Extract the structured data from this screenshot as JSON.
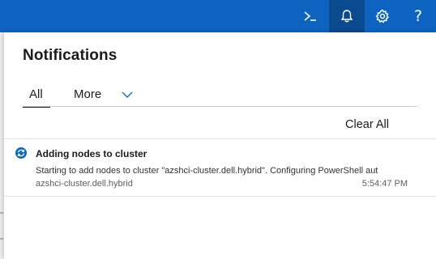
{
  "colors": {
    "topbar": "#0c64c0",
    "topbar_active": "#0a4a8f",
    "accent": "#0f6cbd",
    "text": "#1b1b1b"
  },
  "topbar": {
    "buttons": [
      {
        "icon": "powershell-icon"
      },
      {
        "icon": "bell-icon",
        "active": true
      },
      {
        "icon": "gear-icon"
      },
      {
        "icon": "help-icon",
        "glyph": "?"
      }
    ]
  },
  "panel": {
    "title": "Notifications",
    "tabs": [
      {
        "label": "All",
        "selected": true
      },
      {
        "label": "More",
        "selected": false
      }
    ],
    "clear_all_label": "Clear All",
    "notifications": [
      {
        "icon": "sync-icon",
        "title": "Adding nodes to cluster",
        "message": "Starting to add nodes to cluster \"azshci-cluster.dell.hybrid\". Configuring PowerShell aut",
        "source": "azshci-cluster.dell.hybrid",
        "time": "5:54:47 PM"
      }
    ]
  }
}
